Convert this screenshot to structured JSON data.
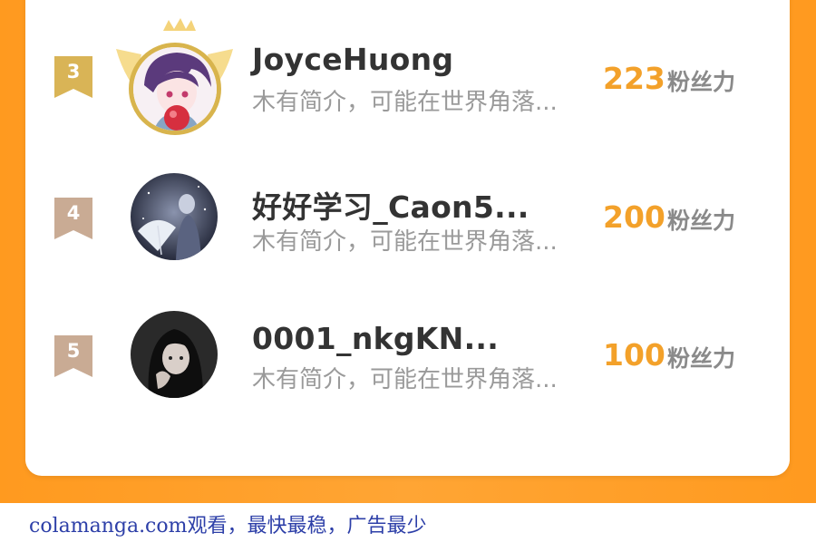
{
  "leaderboard": {
    "rows": [
      {
        "rank": "3",
        "name": "JoyceHuong",
        "bio": "木有简介，可能在世界角落...",
        "score": "223",
        "unit": "粉丝力",
        "avatar_icon": "anime-boy-holding-apple"
      },
      {
        "rank": "4",
        "name": "好好学习_Caon5...",
        "bio": "木有简介，可能在世界角落...",
        "score": "200",
        "unit": "粉丝力",
        "avatar_icon": "night-umbrella-girl"
      },
      {
        "rank": "5",
        "name": "0001_nkgKN...",
        "bio": "木有简介，可能在世界角落...",
        "score": "100",
        "unit": "粉丝力",
        "avatar_icon": "dark-portrait-girl"
      }
    ]
  },
  "footer": {
    "text": "colamanga.com观看，最快最稳，广告最少"
  },
  "colors": {
    "frame": "#ffa534",
    "score": "#f3a12a",
    "rank3_badge": "#d9b456",
    "rank_badge": "#c9ab94",
    "footer_text": "#2d3fa8"
  }
}
